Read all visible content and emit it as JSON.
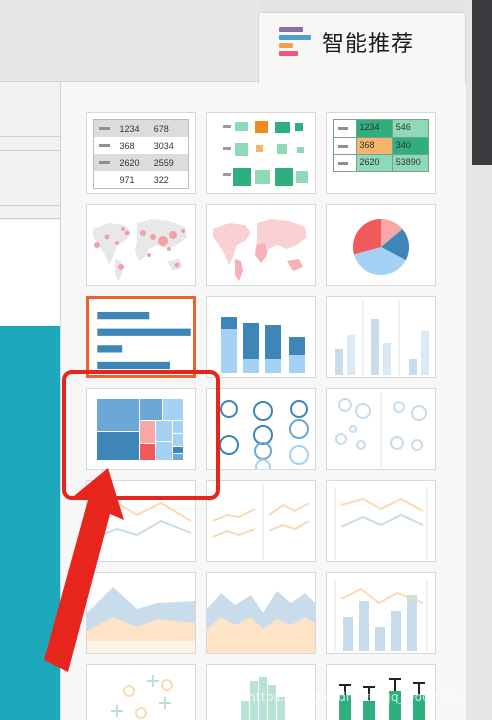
{
  "panel": {
    "title": "智能推荐",
    "tab_icon_colors": [
      "#8a6fa3",
      "#4f9fcf",
      "#f5a04a",
      "#f0577a"
    ]
  },
  "table_chart": {
    "rows": [
      [
        "1234",
        "678"
      ],
      [
        "368",
        "3034"
      ],
      [
        "2620",
        "2559"
      ],
      [
        "971",
        "322"
      ]
    ]
  },
  "colored_table_chart": {
    "rows": [
      [
        "1234",
        "546"
      ],
      [
        "368",
        "340"
      ],
      [
        "2620",
        "53890"
      ]
    ]
  },
  "colors": {
    "annotation": "#e8251d",
    "selected_border": "#f0602a",
    "teal": "#1ea8bb"
  },
  "watermark": "https://blog.csdn.net/qq_Dod0701"
}
